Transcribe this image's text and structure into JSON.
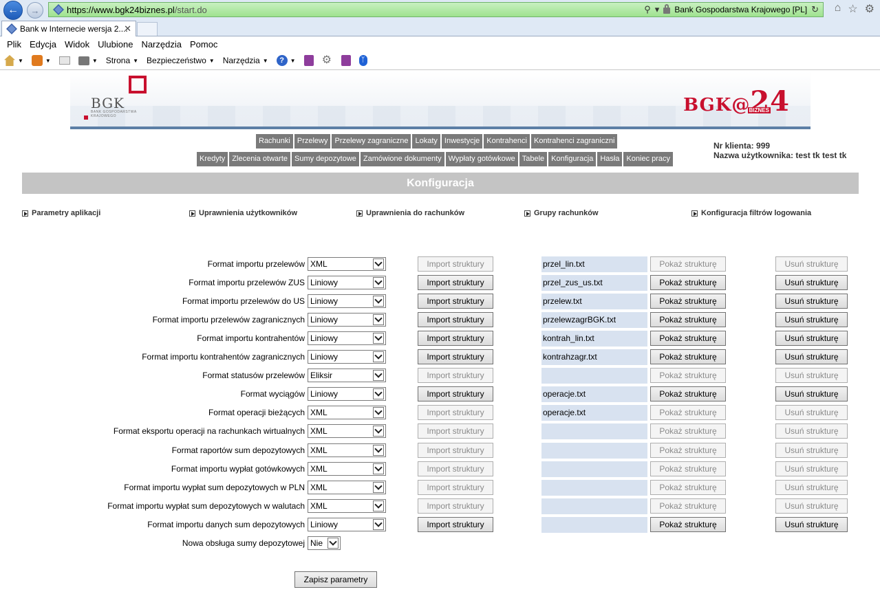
{
  "browser": {
    "url_host": "https://www.bgk24biznes.pl",
    "url_path": "/start.do",
    "cert_label": "Bank Gospodarstwa Krajowego [PL]",
    "tab_title": "Bank w Internecie wersja 2....",
    "menu": [
      "Plik",
      "Edycja",
      "Widok",
      "Ulubione",
      "Narzędzia",
      "Pomoc"
    ],
    "cmd": {
      "strona": "Strona",
      "bezpieczenstwo": "Bezpieczeństwo",
      "narzedzia": "Narzędzia"
    }
  },
  "banner": {
    "bgk": "BGK",
    "bgk_sub": "BANK GOSPODARSTWA KRAJOWEGO",
    "bgk24_prefix": "BGK@",
    "bgk24_num": "24",
    "bgk24_sub": "BIZNES"
  },
  "nav": {
    "row1": [
      "Rachunki",
      "Przelewy",
      "Przelewy zagraniczne",
      "Lokaty",
      "Inwestycje",
      "Kontrahenci",
      "Kontrahenci zagraniczni"
    ],
    "row2": [
      "Kredyty",
      "Zlecenia otwarte",
      "Sumy depozytowe",
      "Zamówione dokumenty",
      "Wypłaty gotówkowe",
      "Tabele",
      "Konfiguracja",
      "Hasła",
      "Koniec pracy"
    ]
  },
  "client": {
    "number_label": "Nr klienta: 999",
    "user_label": "Nazwa użytkownika: test tk test tk"
  },
  "page_title": "Konfiguracja",
  "sub_links": [
    "Parametry aplikacji",
    "Uprawnienia użytkowników",
    "Uprawnienia do rachunków",
    "Grupy rachunków",
    "Konfiguracja filtrów logowania"
  ],
  "buttons": {
    "import": "Import struktury",
    "show": "Pokaż strukturę",
    "delete": "Usuń strukturę",
    "save": "Zapisz parametry"
  },
  "rows": [
    {
      "label": "Format importu przelewów",
      "value": "XML",
      "file": "przel_lin.txt",
      "import_enabled": false,
      "show_enabled": false,
      "delete_enabled": false
    },
    {
      "label": "Format importu przelewów ZUS",
      "value": "Liniowy",
      "file": "przel_zus_us.txt",
      "import_enabled": true,
      "show_enabled": true,
      "delete_enabled": true
    },
    {
      "label": "Format importu przelewów do US",
      "value": "Liniowy",
      "file": "przelew.txt",
      "import_enabled": true,
      "show_enabled": true,
      "delete_enabled": true
    },
    {
      "label": "Format importu przelewów zagranicznych",
      "value": "Liniowy",
      "file": "przelewzagrBGK.txt",
      "import_enabled": true,
      "show_enabled": true,
      "delete_enabled": true
    },
    {
      "label": "Format importu kontrahentów",
      "value": "Liniowy",
      "file": "kontrah_lin.txt",
      "import_enabled": true,
      "show_enabled": true,
      "delete_enabled": true
    },
    {
      "label": "Format importu kontrahentów zagranicznych",
      "value": "Liniowy",
      "file": "kontrahzagr.txt",
      "import_enabled": true,
      "show_enabled": true,
      "delete_enabled": true
    },
    {
      "label": "Format statusów przelewów",
      "value": "Eliksir",
      "file": "",
      "import_enabled": false,
      "show_enabled": false,
      "delete_enabled": false
    },
    {
      "label": "Format wyciągów",
      "value": "Liniowy",
      "file": "operacje.txt",
      "import_enabled": true,
      "show_enabled": true,
      "delete_enabled": true
    },
    {
      "label": "Format operacji bieżących",
      "value": "XML",
      "file": "operacje.txt",
      "import_enabled": false,
      "show_enabled": false,
      "delete_enabled": false
    },
    {
      "label": "Format eksportu operacji na rachunkach wirtualnych",
      "value": "XML",
      "file": "",
      "import_enabled": false,
      "show_enabled": false,
      "delete_enabled": false
    },
    {
      "label": "Format raportów sum depozytowych",
      "value": "XML",
      "file": "",
      "import_enabled": false,
      "show_enabled": false,
      "delete_enabled": false
    },
    {
      "label": "Format importu wypłat gotówkowych",
      "value": "XML",
      "file": "",
      "import_enabled": false,
      "show_enabled": false,
      "delete_enabled": false
    },
    {
      "label": "Format importu wypłat sum depozytowych w PLN",
      "value": "XML",
      "file": "",
      "import_enabled": false,
      "show_enabled": false,
      "delete_enabled": false
    },
    {
      "label": "Format importu wypłat sum depozytowych w walutach",
      "value": "XML",
      "file": "",
      "import_enabled": false,
      "show_enabled": false,
      "delete_enabled": false
    },
    {
      "label": "Format importu danych sum depozytowych",
      "value": "Liniowy",
      "file": "",
      "import_enabled": true,
      "show_enabled": true,
      "delete_enabled": true
    }
  ],
  "deposit_option": {
    "label": "Nowa obsługa sumy depozytowej",
    "value": "Nie"
  },
  "colors": {
    "nav_bg": "#7a7a7a",
    "title_bar": "#c4c4c4",
    "file_cell": "#d8e2f0",
    "brand_red": "#c8102e"
  },
  "icons": [
    "back-arrow-icon",
    "forward-arrow-icon",
    "search-icon",
    "lock-icon",
    "refresh-icon",
    "home-icon",
    "star-icon",
    "gear-icon",
    "rss-icon",
    "mail-icon",
    "print-icon",
    "help-icon",
    "bluetooth-icon",
    "play-icon",
    "chevron-down-icon"
  ]
}
